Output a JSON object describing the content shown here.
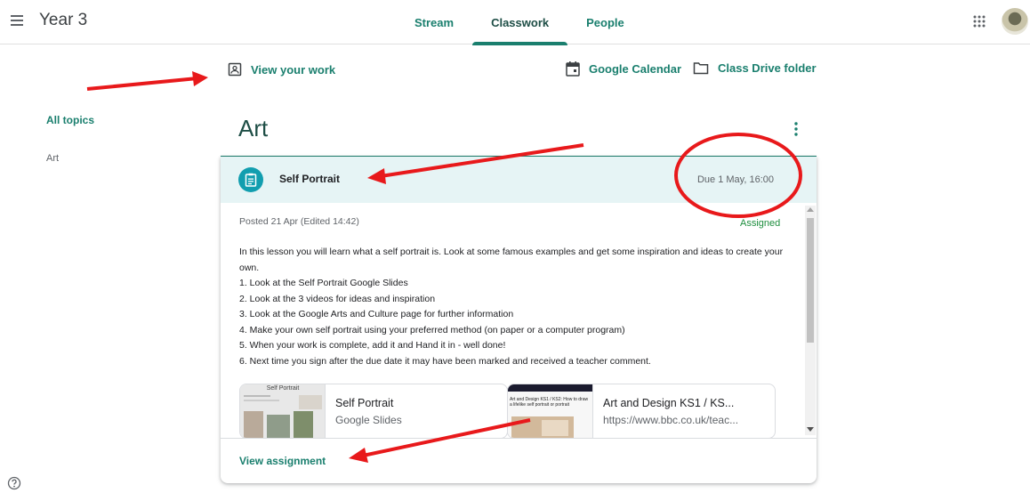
{
  "header": {
    "class_title": "Year 3",
    "tabs": [
      {
        "label": "Stream"
      },
      {
        "label": "Classwork"
      },
      {
        "label": "People"
      }
    ]
  },
  "actions": {
    "view_work": "View your work",
    "calendar": "Google Calendar",
    "drive": "Class Drive folder"
  },
  "sidebar": {
    "all_topics": "All topics",
    "topics": [
      "Art"
    ]
  },
  "topic": {
    "title": "Art"
  },
  "assignment": {
    "title": "Self Portrait",
    "due": "Due 1 May, 16:00",
    "posted": "Posted 21 Apr (Edited 14:42)",
    "status": "Assigned",
    "description": [
      "In this lesson you will learn what a self portrait is. Look at some famous examples and get some inspiration and ideas to create your own.",
      "1. Look at the Self Portrait Google Slides",
      "2. Look at the 3 videos for ideas and inspiration",
      "3. Look at the Google Arts and Culture page for further information",
      "4. Make your own self portrait using your preferred method (on paper or a computer program)",
      "5. When your work is complete, add it and Hand it in - well done!",
      "6. Next time you sign after the due date it may have been marked and received a teacher comment."
    ],
    "attachments": [
      {
        "title": "Self Portrait",
        "subtitle": "Google Slides",
        "thumb_caption": "Self Portrait"
      },
      {
        "title": "Art and Design KS1 / KS...",
        "subtitle": "https://www.bbc.co.uk/teac...",
        "thumb_caption": "Art and Design KS1 / KS2: How to draw a lifelike self portrait or portrait"
      }
    ],
    "view_assignment": "View assignment"
  },
  "colors": {
    "accent": "#1a7f6e",
    "header_bg": "#e6f4f5",
    "annotation_red": "#e8191b"
  }
}
